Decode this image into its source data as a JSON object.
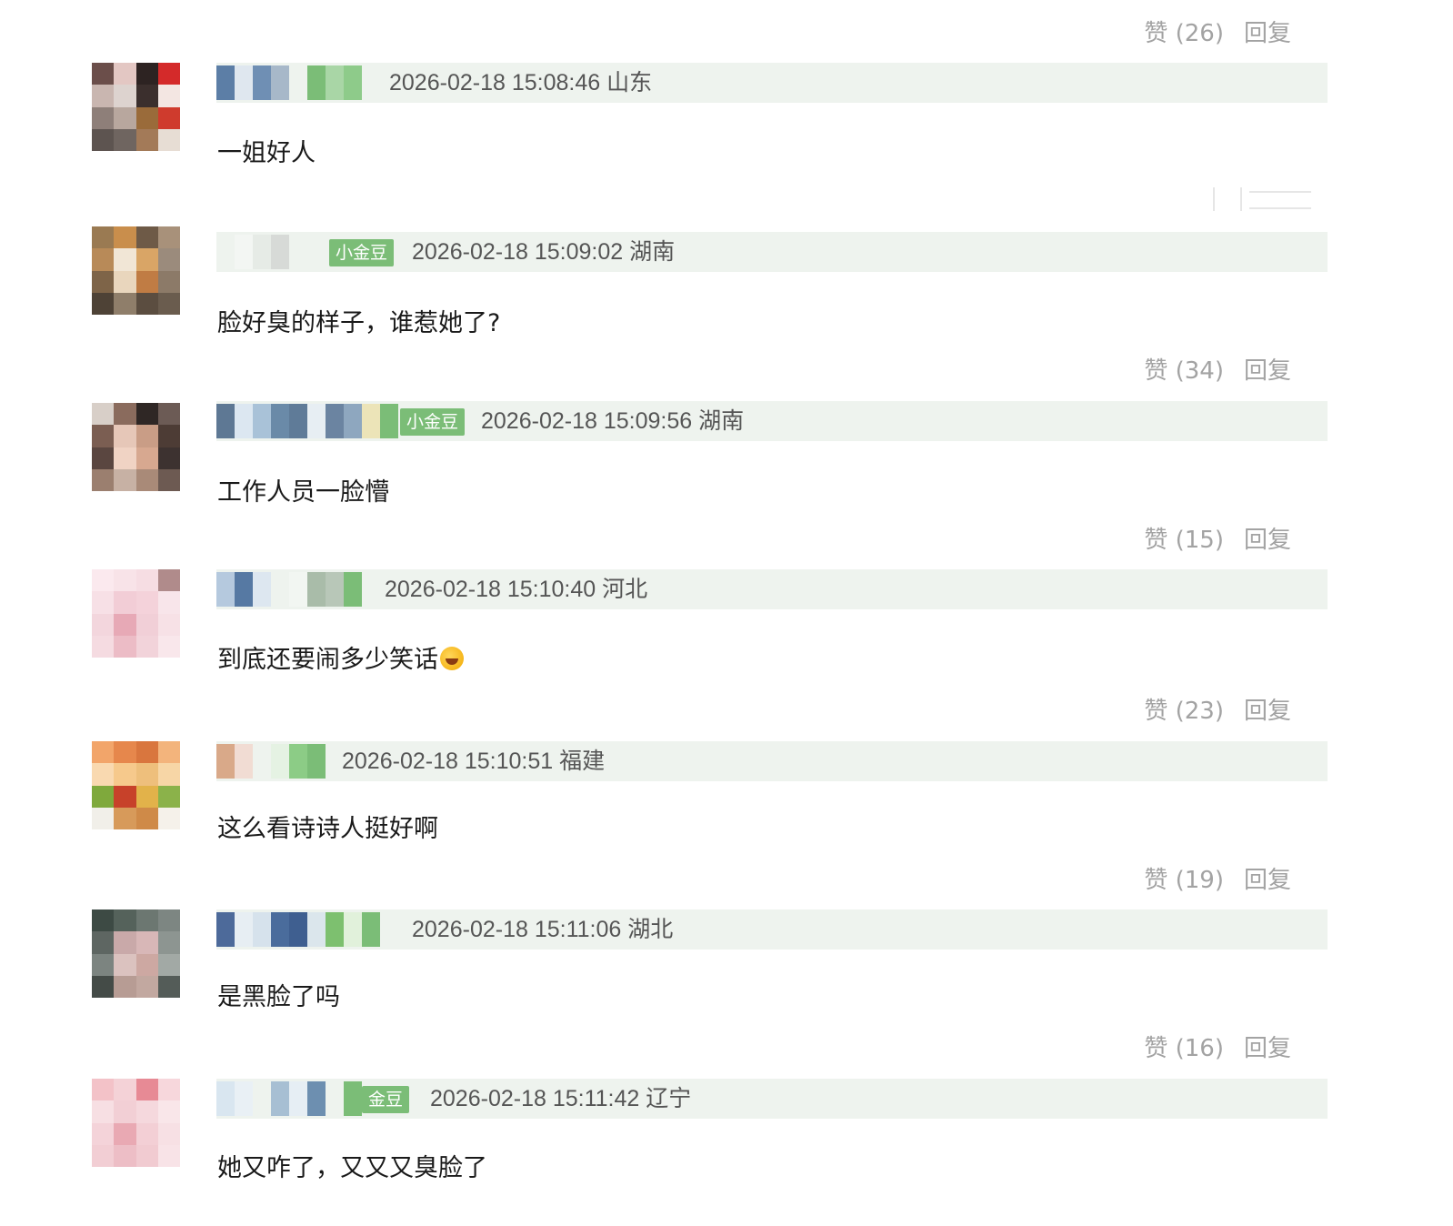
{
  "top_actions": {
    "like_label": "赞 (26)",
    "reply_label": "回复"
  },
  "comments": [
    {
      "badge": "",
      "timestamp": "2026-02-18 15:08:46",
      "location": "山东",
      "text": "一姐好人",
      "like_label": "赞 (26)",
      "reply_label": "回复"
    },
    {
      "badge": "小金豆",
      "timestamp": "2026-02-18 15:09:02",
      "location": "湖南",
      "text": "脸好臭的样子，谁惹她了?",
      "like_label": "赞 (34)",
      "reply_label": "回复"
    },
    {
      "badge": "小金豆",
      "timestamp": "2026-02-18 15:09:56",
      "location": "湖南",
      "text": "工作人员一脸懵",
      "like_label": "赞 (15)",
      "reply_label": "回复"
    },
    {
      "badge": "",
      "timestamp": "2026-02-18 15:10:40",
      "location": "河北",
      "text": "到底还要闹多少笑话",
      "like_label": "赞 (23)",
      "reply_label": "回复"
    },
    {
      "badge": "",
      "timestamp": "2026-02-18 15:10:51",
      "location": "福建",
      "text": "这么看诗诗人挺好啊",
      "like_label": "赞 (19)",
      "reply_label": "回复"
    },
    {
      "badge": "",
      "timestamp": "2026-02-18 15:11:06",
      "location": "湖北",
      "text": "是黑脸了吗",
      "like_label": "赞 (16)",
      "reply_label": "回复"
    },
    {
      "badge": "金豆",
      "timestamp": "2026-02-18 15:11:42",
      "location": "辽宁",
      "text": "她又咋了，又又又臭脸了",
      "like_label": "",
      "reply_label": ""
    }
  ],
  "colors": {
    "header_bg": "#eef3ee",
    "badge_green": "#7bbd77",
    "action_gray": "#a3a3a3",
    "meta_gray": "#555555",
    "text_dark": "#1a1a1a"
  },
  "icons": {
    "emoji_last_comment_4": "rofl-emoji-icon"
  }
}
